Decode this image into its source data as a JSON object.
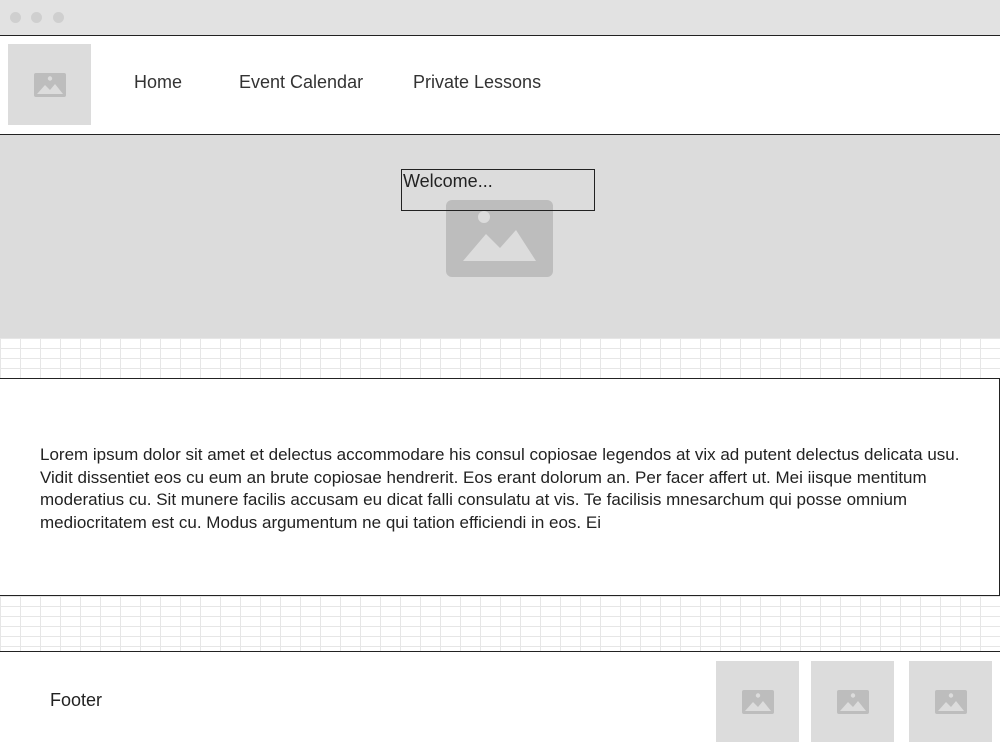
{
  "nav": {
    "items": [
      {
        "label": "Home"
      },
      {
        "label": "Event Calendar"
      },
      {
        "label": "Private Lessons"
      }
    ]
  },
  "hero": {
    "welcome_text": "Welcome..."
  },
  "content": {
    "paragraph": "Lorem ipsum dolor sit amet et delectus accommodare his consul copiosae legendos at vix ad putent delectus delicata usu. Vidit dissentiet eos cu eum an brute copiosae hendrerit. Eos erant dolorum an. Per facer affert ut. Mei iisque mentitum moderatius cu. Sit munere facilis accusam eu dicat falli consulatu at vis. Te facilisis mnesarchum qui posse omnium mediocritatem est cu. Modus argumentum ne qui tation efficiendi in eos. Ei"
  },
  "footer": {
    "label": "Footer"
  },
  "colors": {
    "placeholder_bg": "#dcdcdc",
    "placeholder_icon": "#bdbdbd",
    "border": "#222222"
  },
  "icons": {
    "logo": "image-placeholder-icon",
    "hero": "image-placeholder-icon",
    "thumbs": [
      "image-placeholder-icon",
      "image-placeholder-icon",
      "image-placeholder-icon"
    ]
  }
}
